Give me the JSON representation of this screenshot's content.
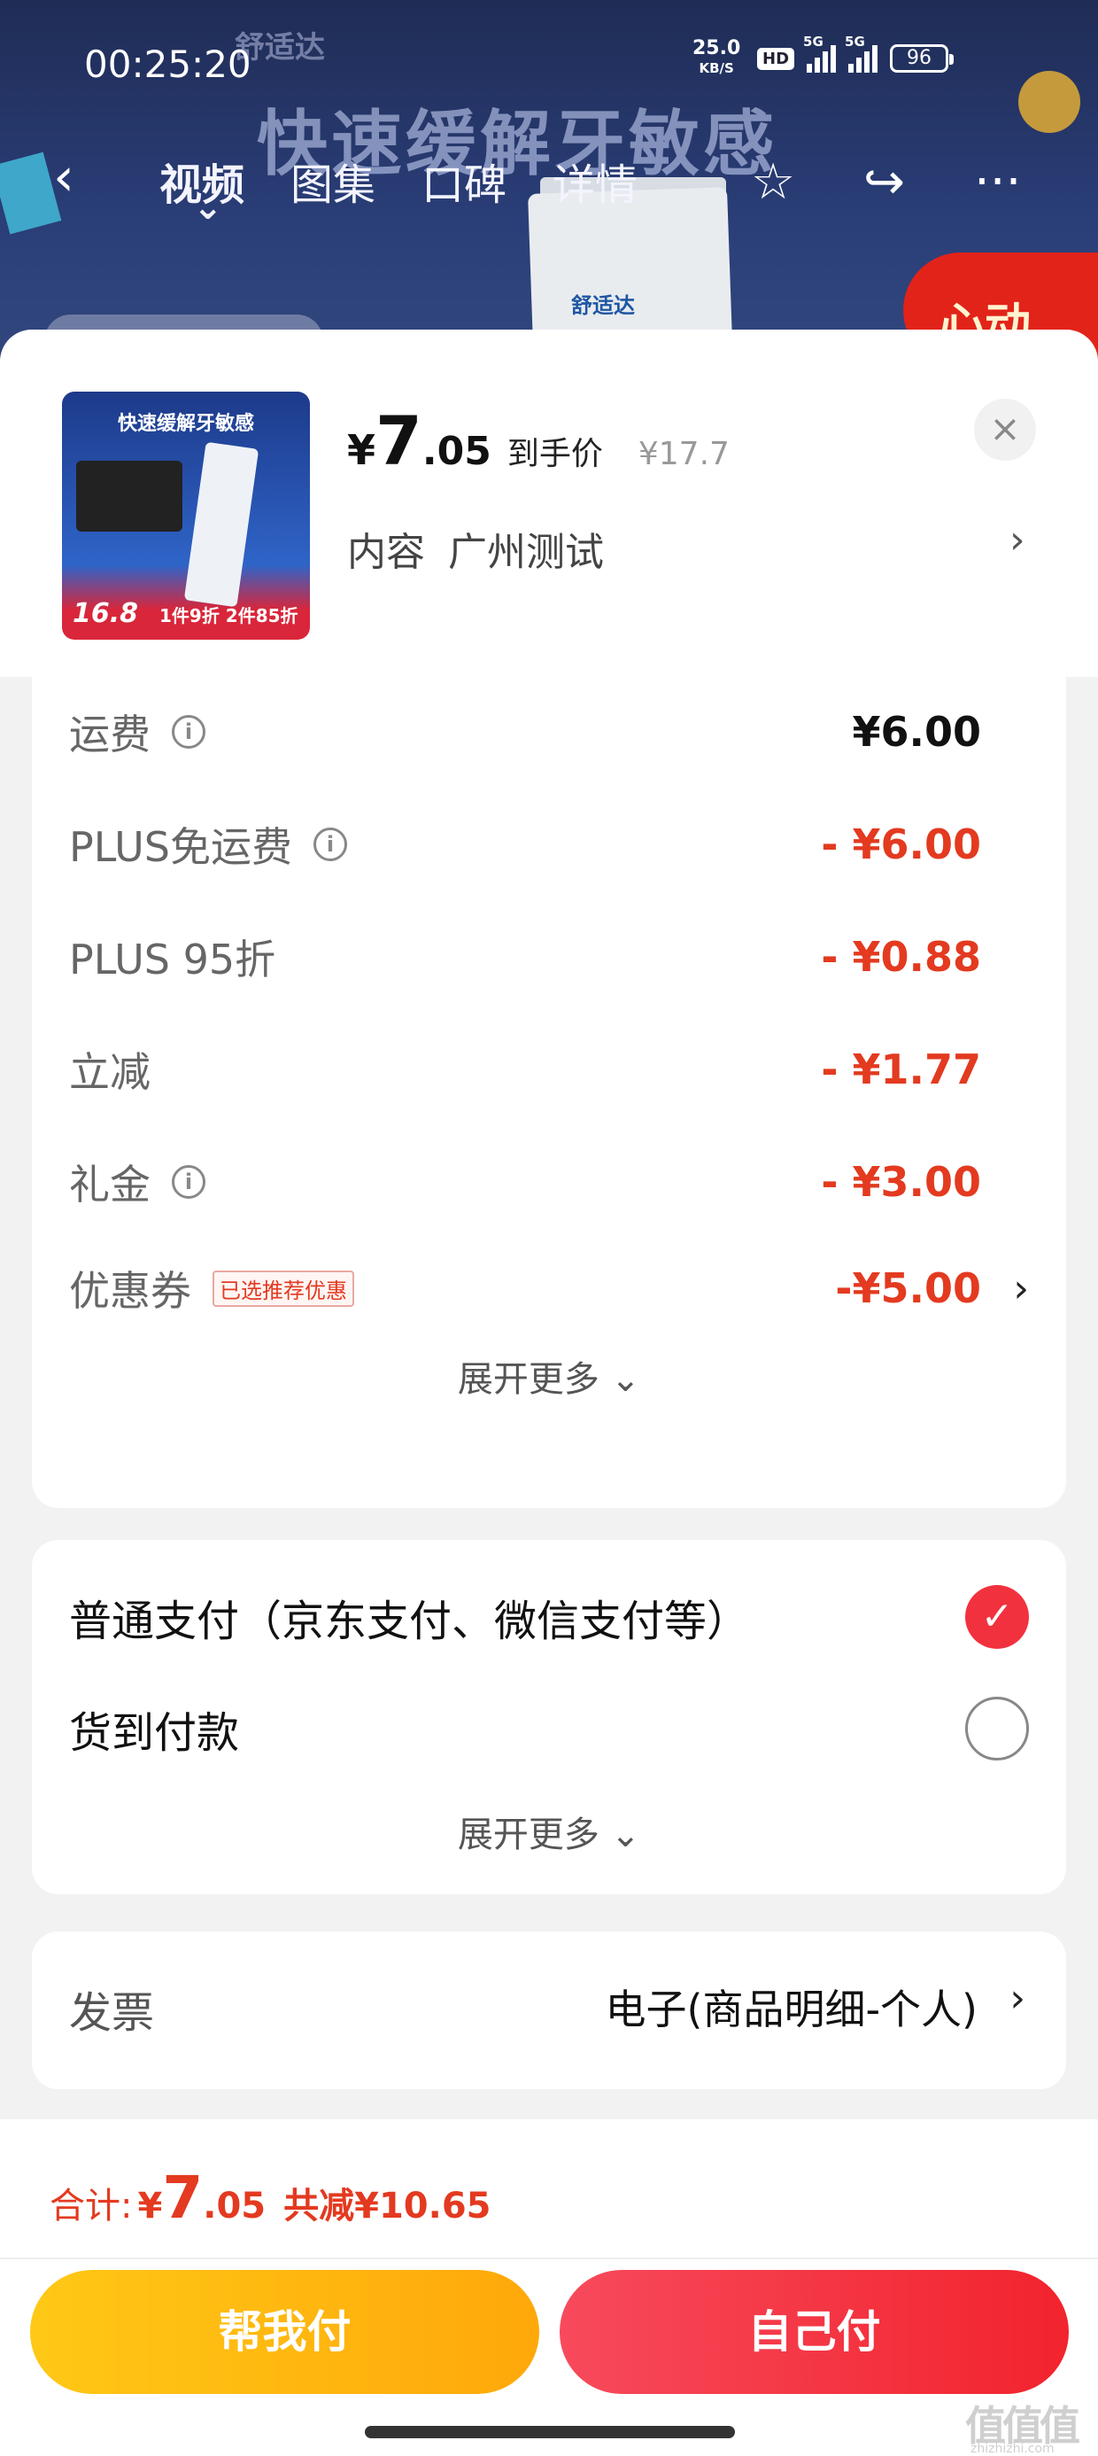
{
  "status_bar": {
    "time": "00:25:20",
    "net_speed_value": "25.0",
    "net_speed_unit": "KB/S",
    "hd": "HD",
    "sig1": "5G",
    "sig2": "5G",
    "battery": "96"
  },
  "background": {
    "headline": "快速缓解牙敏感",
    "brand": "舒适达",
    "tube_brand": "舒适达",
    "red_tag": "心动"
  },
  "nav": {
    "back": "‹",
    "tabs": [
      "视频",
      "图集",
      "口碑",
      "详情"
    ],
    "star": "☆",
    "share": "↪",
    "more": "···"
  },
  "product": {
    "thumb_title": "快速缓解牙敏感",
    "thumb_price": "16.8",
    "thumb_promo": "1件9折  2件85折",
    "currency": "¥",
    "price_int": "7",
    "price_dec": ".05",
    "price_tag": "到手价",
    "original_price": "¥17.7",
    "spec_label": "内容",
    "spec_value": "广州测试",
    "close": "×",
    "arrow": "›"
  },
  "fees": {
    "rows": [
      {
        "label": "运费",
        "value": "¥6.00"
      },
      {
        "label": "PLUS免运费",
        "value": "- ¥6.00"
      },
      {
        "label": "PLUS 95折",
        "value": "- ¥0.88"
      },
      {
        "label": "立减",
        "value": "- ¥1.77"
      },
      {
        "label": "礼金",
        "value": "- ¥3.00"
      },
      {
        "label": "优惠券",
        "value": "-¥5.00",
        "badge": "已选推荐优惠"
      }
    ],
    "expand": "展开更多 ⌄",
    "info_glyph": "i"
  },
  "payment": {
    "options": [
      {
        "label": "普通支付（京东支付、微信支付等）",
        "selected": true
      },
      {
        "label": "货到付款",
        "selected": false
      }
    ],
    "check": "✓",
    "expand": "展开更多 ⌄"
  },
  "invoice": {
    "label": "发票",
    "value": "电子(商品明细-个人)",
    "arrow": "›"
  },
  "footer": {
    "total_label": "合计:",
    "currency": "¥",
    "total_int": "7",
    "total_dec": ".05",
    "saved": "共减¥10.65",
    "help_pay": "帮我付",
    "self_pay": "自己付",
    "watermark": "值值值",
    "watermark_sub": "zhizhizhi.com"
  },
  "colors": {
    "accent_red": "#e33a20",
    "pay_yellow": "#ffb511",
    "pay_red": "#f2313f"
  }
}
